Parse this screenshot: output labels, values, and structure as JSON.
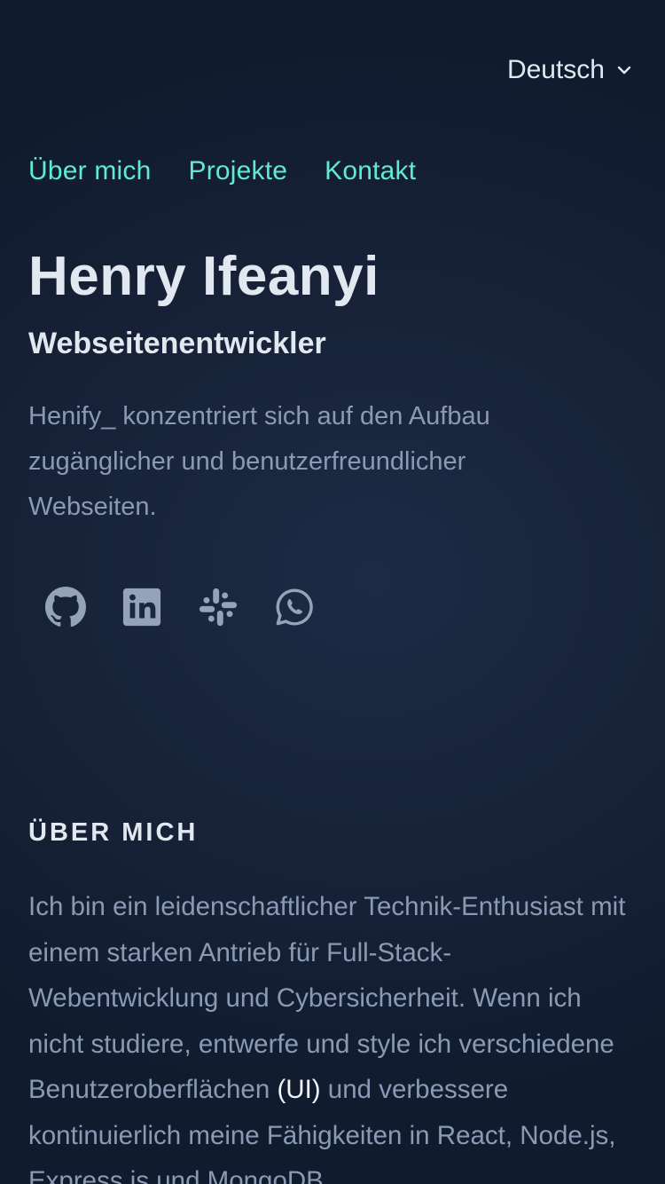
{
  "language": {
    "selected": "Deutsch"
  },
  "nav": {
    "items": [
      {
        "label": "Über mich"
      },
      {
        "label": "Projekte"
      },
      {
        "label": "Kontakt"
      }
    ]
  },
  "hero": {
    "name": "Henry Ifeanyi",
    "role": "Webseitenentwickler",
    "description": "Henify_ konzentriert sich auf den Aufbau zugänglicher und benutzerfreundlicher Webseiten."
  },
  "socials": [
    {
      "icon": "github-icon"
    },
    {
      "icon": "linkedin-icon"
    },
    {
      "icon": "slack-icon"
    },
    {
      "icon": "whatsapp-icon"
    }
  ],
  "about": {
    "title": "ÜBER MICH",
    "text_before": "Ich bin ein leidenschaftlicher Technik-Enthusiast mit einem starken Antrieb für Full-Stack-Webentwicklung und Cybersicherheit. Wenn ich nicht studiere, entwerfe und style ich verschiedene Benutzeroberflächen ",
    "highlight": "(UI)",
    "text_after": " und verbessere kontinuierlich meine Fähigkeiten in React, Node.js, Express.js und MongoDB."
  },
  "colors": {
    "accent": "#5eead4",
    "heading": "#e2e8f0",
    "body_text": "#8b9ab4",
    "background": "#172238"
  }
}
